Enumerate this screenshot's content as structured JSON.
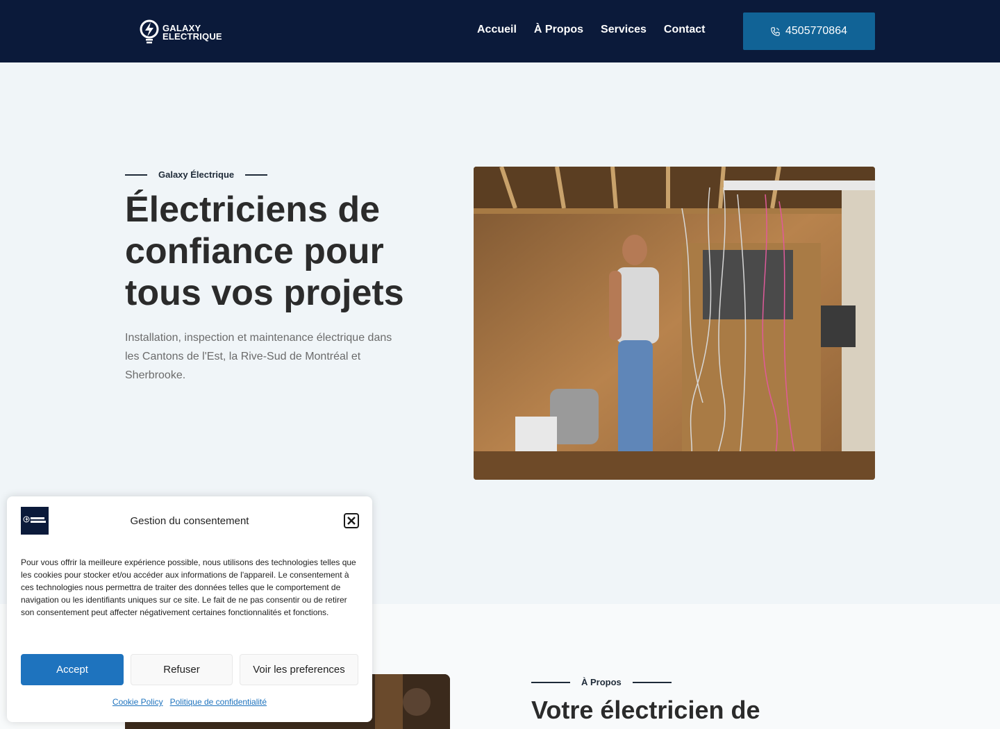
{
  "header": {
    "logo_line1": "GALAXY",
    "logo_line2": "ELECTRIQUE",
    "nav": [
      "Accueil",
      "À Propos",
      "Services",
      "Contact"
    ],
    "phone": "4505770864",
    "phone_icon": "phone-icon",
    "bg_color": "#0b1a3a",
    "accent": "#116396"
  },
  "hero": {
    "eyebrow": "Galaxy Électrique",
    "title": "Électriciens de confiance pour tous vos projets",
    "description": "Installation, inspection et maintenance électrique dans les Cantons de l'Est, la Rive-Sud de Montréal et Sherbrooke."
  },
  "about": {
    "eyebrow": "À Propos",
    "title": "Votre électricien de"
  },
  "consent": {
    "title": "Gestion du consentement",
    "text": "Pour vous offrir la meilleure expérience possible, nous utilisons des technologies telles que les cookies pour stocker et/ou accéder aux informations de l'appareil. Le consentement à ces technologies nous permettra de traiter des données telles que le comportement de navigation ou les identifiants uniques sur ce site. Le fait de ne pas consentir ou de retirer son consentement peut affecter négativement certaines fonctionnalités et fonctions.",
    "accept": "Accept",
    "deny": "Refuser",
    "preferences": "Voir les preferences",
    "links": [
      "Cookie Policy",
      "Politique de confidentialité"
    ],
    "accent": "#1e73be"
  }
}
